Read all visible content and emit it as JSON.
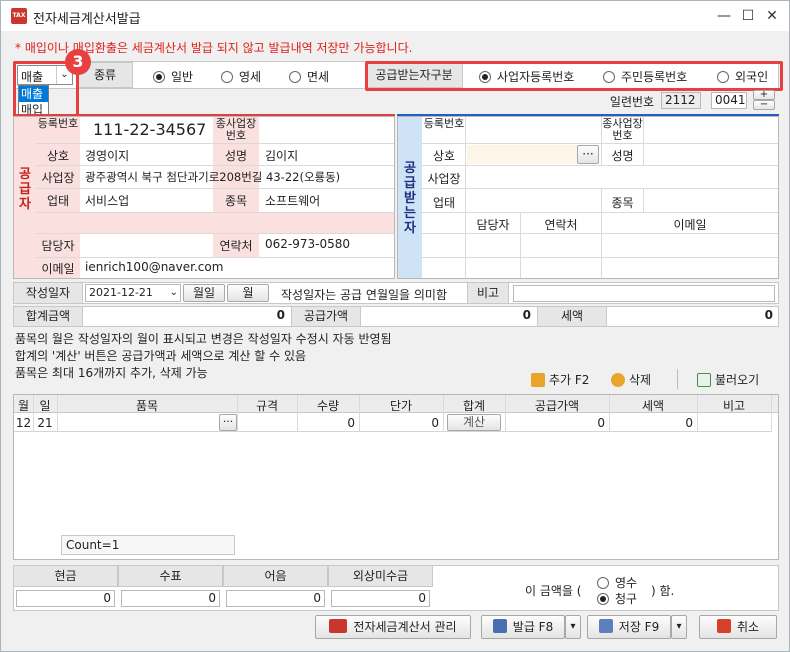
{
  "window": {
    "title": "전자세금계산서발급",
    "minimize": "—",
    "restore": "☐",
    "close": "✕",
    "app_icon_text": "TAX"
  },
  "warning": "* 매입이나 매입환출은 세금계산서 발급 되지 않고 발급내역 저장만 가능합니다.",
  "badge": "3",
  "sale_type": {
    "selected": "매출",
    "options": [
      "매출",
      "매입"
    ]
  },
  "kind": {
    "label": "종류",
    "options": [
      {
        "label": "일반",
        "checked": true
      },
      {
        "label": "영세",
        "checked": false
      },
      {
        "label": "면세",
        "checked": false
      }
    ]
  },
  "receiver_type": {
    "label": "공급받는자구분",
    "options": [
      {
        "label": "사업자등록번호",
        "checked": true
      },
      {
        "label": "주민등록번호",
        "checked": false
      },
      {
        "label": "외국인",
        "checked": false
      }
    ]
  },
  "serial": {
    "label": "일련번호",
    "value1": "2112",
    "value2": "0041",
    "plus": "+",
    "minus": "−"
  },
  "supplier": {
    "side_label": "공급자",
    "reg_label": "등록번호",
    "reg_value": "111-22-34567",
    "sub_label": "종사업장번호",
    "sub_value": "",
    "name_label": "상호",
    "name_value": "경영이지",
    "rep_label": "성명",
    "rep_value": "김이지",
    "addr_label": "사업장",
    "addr_value": "광주광역시 북구 첨단과기로208번길 43-22(오룡동)",
    "biz_label": "업태",
    "biz_value": "서비스업",
    "item_label": "종목",
    "item_value": "소프트웨어",
    "contact_label": "담당자",
    "contact_value": "",
    "phone_label": "연락처",
    "phone_value": "062-973-0580",
    "email_label": "이메일",
    "email_value": "ienrich100@naver.com"
  },
  "buyer": {
    "side_label": "공급받는자",
    "reg_label": "등록번호",
    "sub_label": "종사업장번호",
    "name_label": "상호",
    "name_btn": "···",
    "rep_label": "성명",
    "addr_label": "사업장",
    "biz_label": "업태",
    "item_label": "종목",
    "contact_label": "담당자",
    "phone_label": "연락처",
    "email_label": "이메일"
  },
  "date_row": {
    "label": "작성일자",
    "date": "2021-12-21",
    "btn_month_day": "월일",
    "btn_month": "월",
    "note": "작성일자는 공급 연월일을 의미함",
    "memo_label": "비고"
  },
  "total_row": {
    "total_label": "합계금액",
    "total_value": "0",
    "supply_label": "공급가액",
    "supply_value": "0",
    "tax_label": "세액",
    "tax_value": "0"
  },
  "notes": [
    "품목의 월은 작성일자의 월이 표시되고 변경은 작성일자 수정시 자동 반영됨",
    "합계의 '계산' 버튼은 공급가액과 세액으로 계산 할 수 있음",
    "품목은 최대 16개까지 추가, 삭제 가능"
  ],
  "toolbar": {
    "add": "추가 F2",
    "delete": "삭제",
    "load": "불러오기"
  },
  "items_table": {
    "headers": [
      "월",
      "일",
      "품목",
      "규격",
      "수량",
      "단가",
      "합계",
      "공급가액",
      "세액",
      "비고"
    ],
    "row": {
      "month": "12",
      "day": "21",
      "item": "",
      "item_btn": "···",
      "spec": "",
      "qty": "0",
      "price": "0",
      "calc_btn": "계산",
      "supply": "0",
      "tax": "0",
      "memo": ""
    },
    "count": "Count=1"
  },
  "payment": {
    "headers": [
      "현금",
      "수표",
      "어음",
      "외상미수금"
    ],
    "values": [
      "0",
      "0",
      "0",
      "0"
    ],
    "prefix": "이 금액을 (",
    "receipt": "영수",
    "claim": "청구",
    "suffix": ") 함."
  },
  "footer": {
    "manage": "전자세금계산서 관리",
    "issue": "발급 F8",
    "save": "저장 F9",
    "cancel": "취소",
    "dropdown": "▾"
  }
}
